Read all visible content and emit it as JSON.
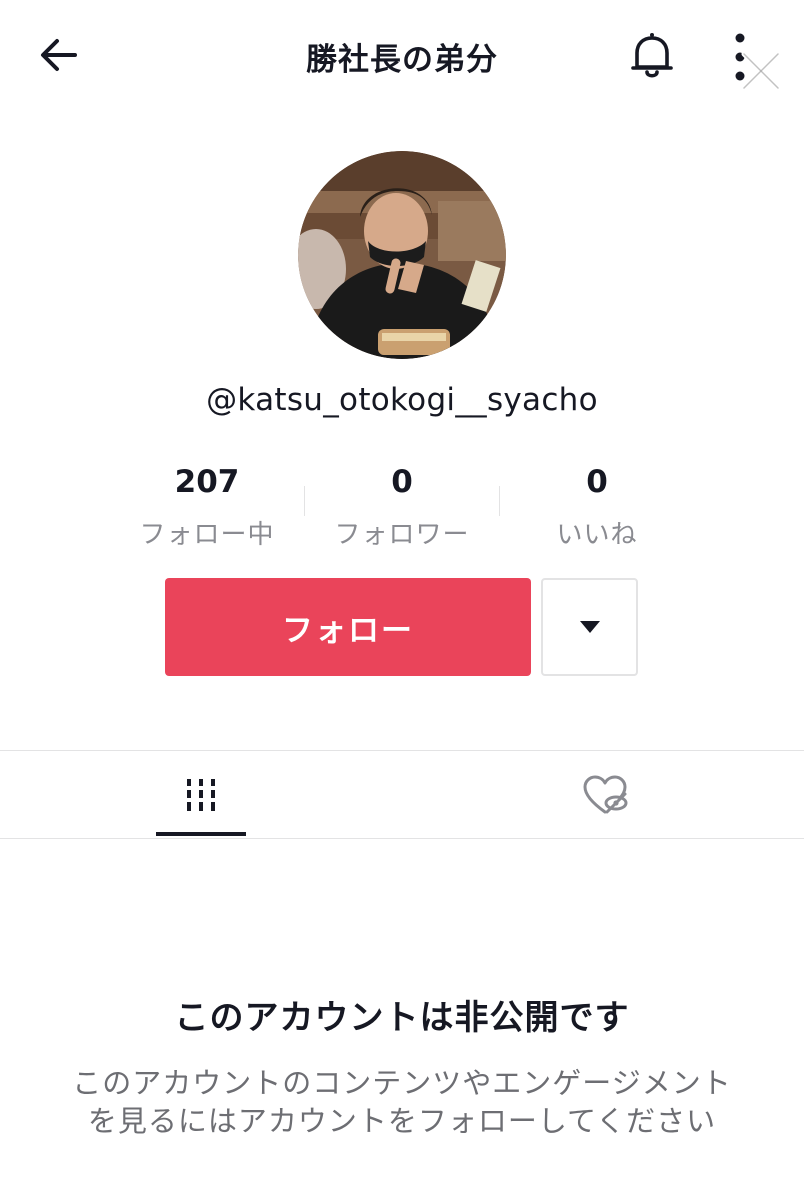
{
  "header": {
    "title": "勝社長の弟分",
    "back_icon": "arrow-left-icon",
    "notification_icon": "bell-icon",
    "more_icon": "more-vertical-icon",
    "close_icon": "close-icon"
  },
  "profile": {
    "username": "@katsu_otokogi__syacho",
    "avatar_alt": "profile photo"
  },
  "stats": [
    {
      "value": "207",
      "label": "フォロー中"
    },
    {
      "value": "0",
      "label": "フォロワー"
    },
    {
      "value": "0",
      "label": "いいね"
    }
  ],
  "actions": {
    "follow_label": "フォロー",
    "dropdown_icon": "triangle-down-icon"
  },
  "tabs": [
    {
      "name": "videos",
      "icon": "grid-bars-icon",
      "selected": true
    },
    {
      "name": "liked",
      "icon": "heart-hidden-icon",
      "selected": false
    }
  ],
  "private_notice": {
    "title": "このアカウントは非公開です",
    "line1": "このアカウントのコンテンツやエンゲージメント",
    "line2": "を見るにはアカウントをフォローしてください"
  },
  "colors": {
    "accent": "#ea445a",
    "text_primary": "#161823",
    "text_secondary": "#8a8b91",
    "divider": "#e3e3e4"
  }
}
